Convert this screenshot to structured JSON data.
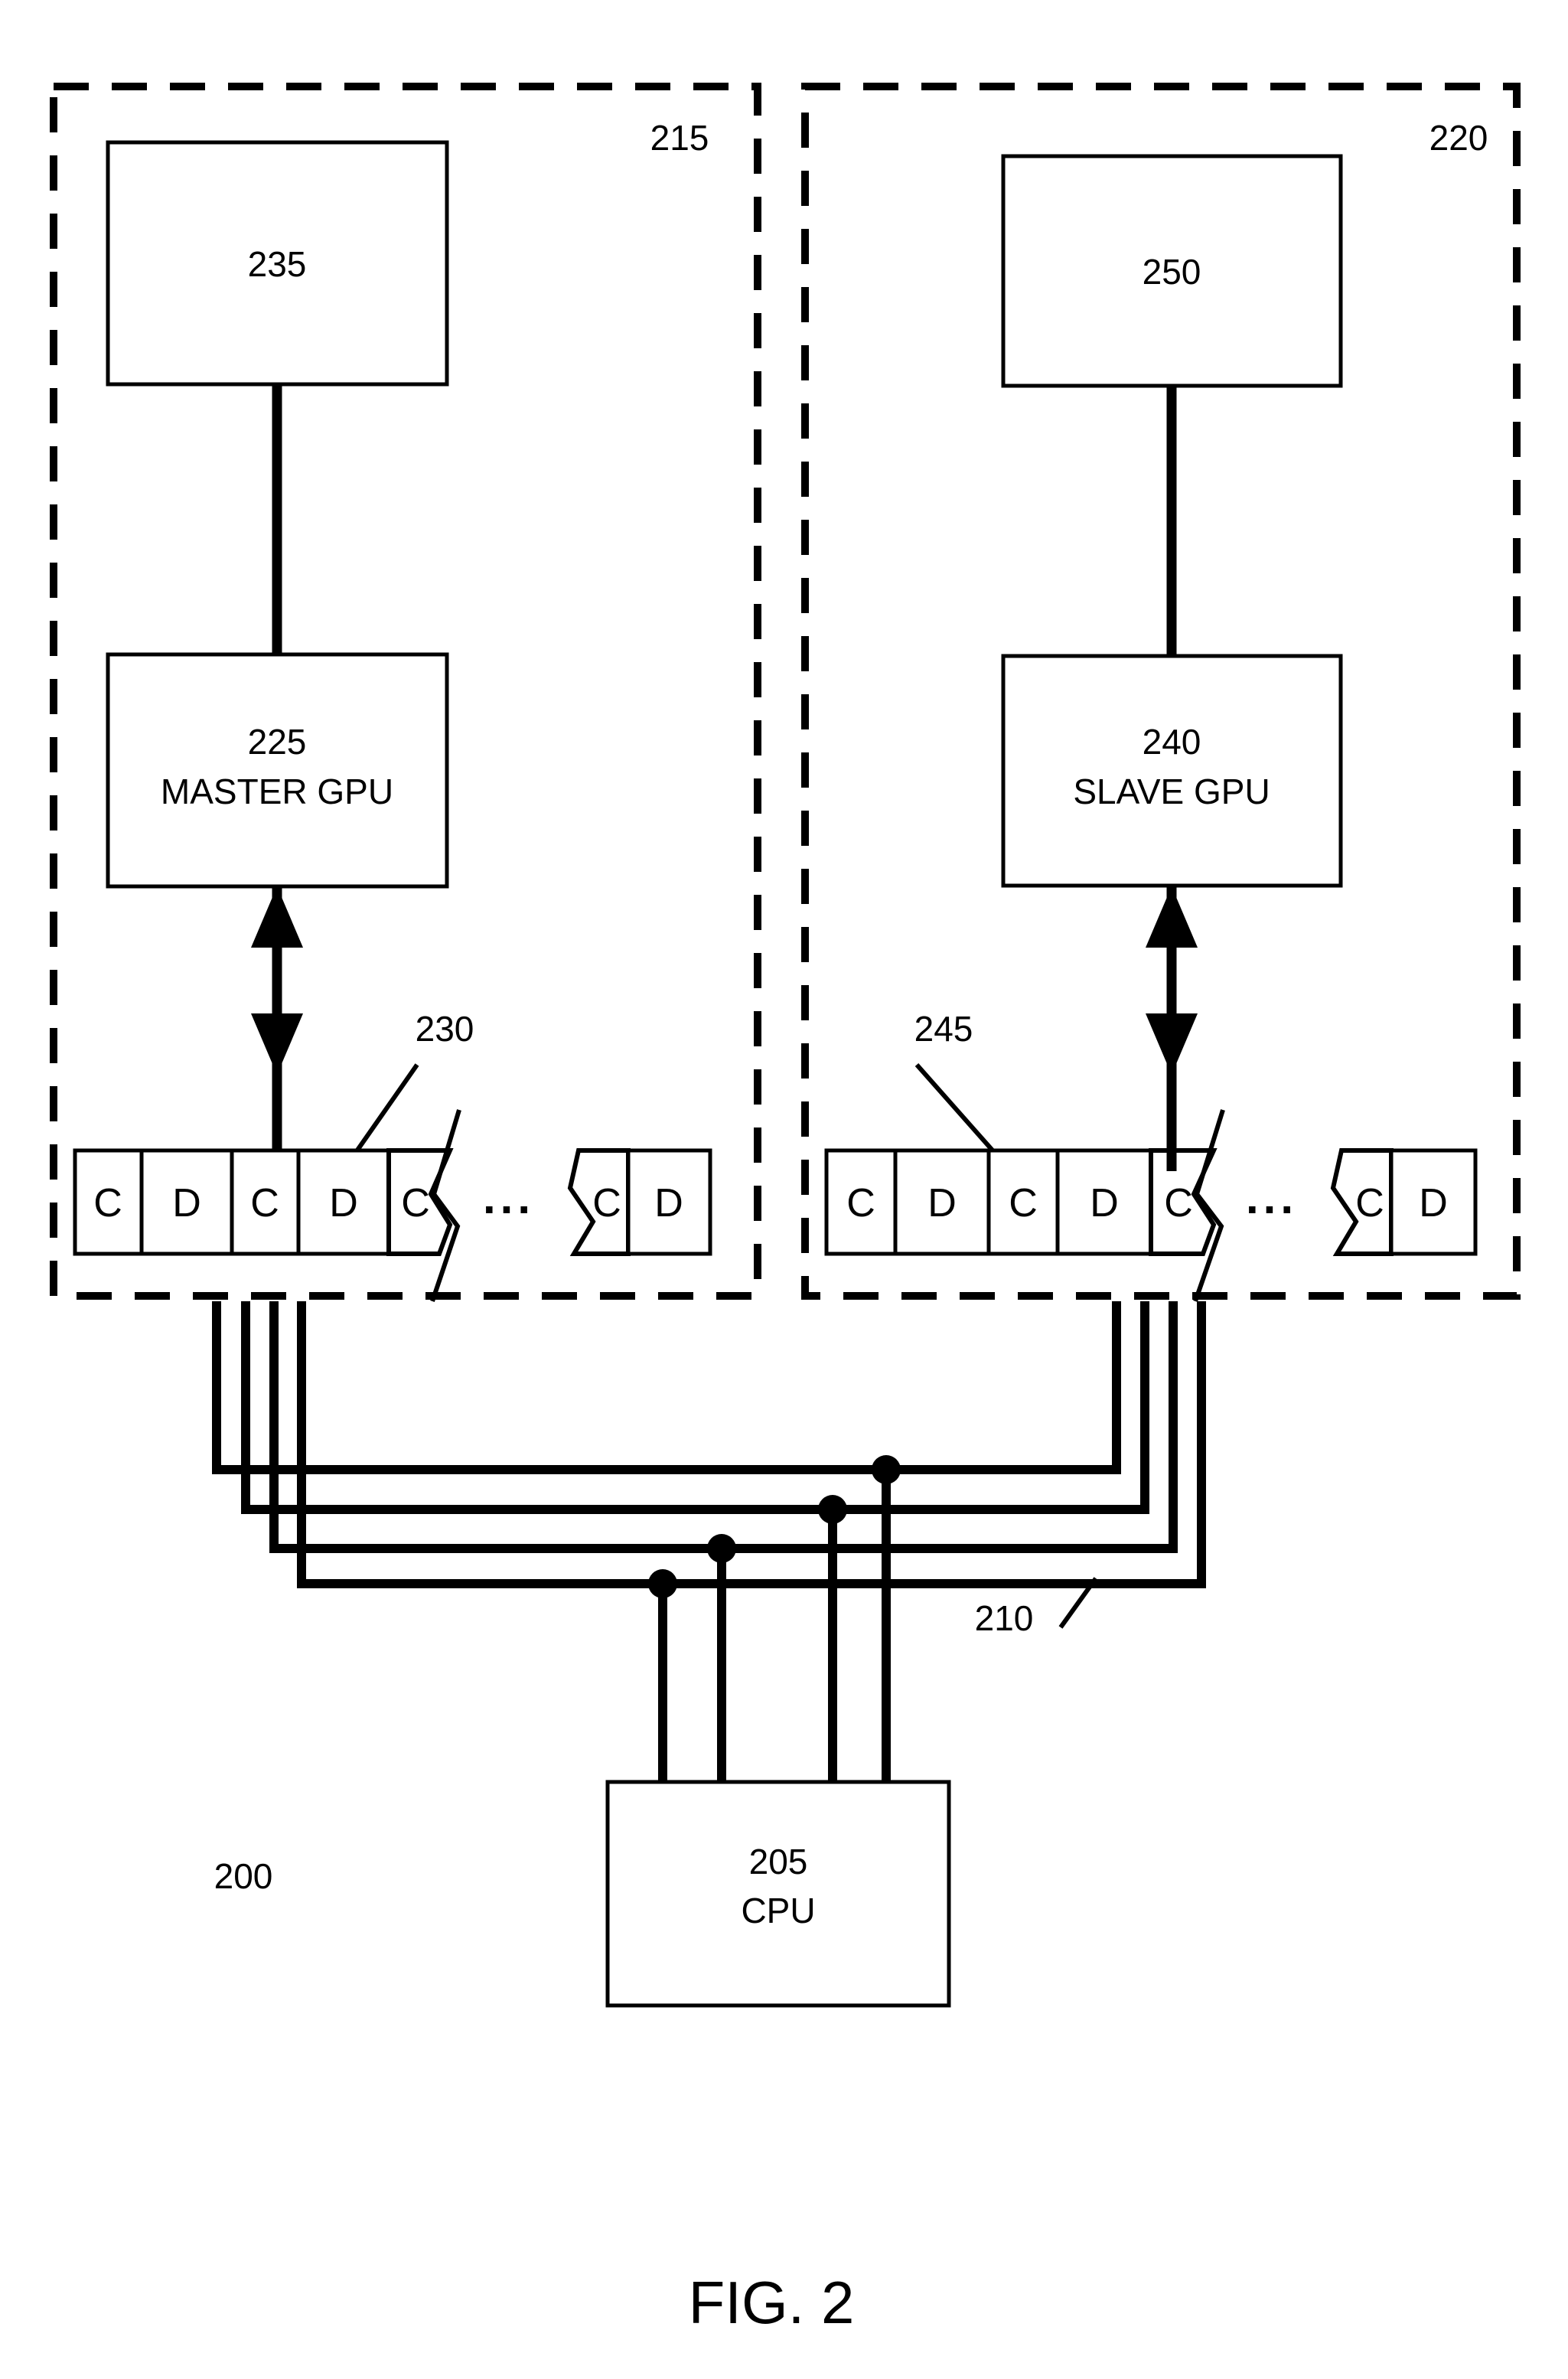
{
  "figure": {
    "caption": "FIG. 2",
    "system_ref": "200",
    "bus_ref": "210"
  },
  "groups": {
    "left": {
      "ref": "215",
      "queue_ref": "230",
      "top_box": {
        "ref": "235",
        "label": ""
      },
      "gpu_box": {
        "ref": "225",
        "label": "MASTER GPU"
      },
      "queue_cells": [
        "C",
        "D",
        "C",
        "D",
        "C",
        "C",
        "D"
      ],
      "queue_ellipsis": "..."
    },
    "right": {
      "ref": "220",
      "queue_ref": "245",
      "top_box": {
        "ref": "250",
        "label": ""
      },
      "gpu_box": {
        "ref": "240",
        "label": "SLAVE GPU"
      },
      "queue_cells": [
        "C",
        "D",
        "C",
        "D",
        "C",
        "C",
        "D"
      ],
      "queue_ellipsis": "..."
    }
  },
  "cpu": {
    "ref": "205",
    "label": "CPU"
  },
  "colors": {
    "stroke": "#000000",
    "fill": "#ffffff"
  }
}
